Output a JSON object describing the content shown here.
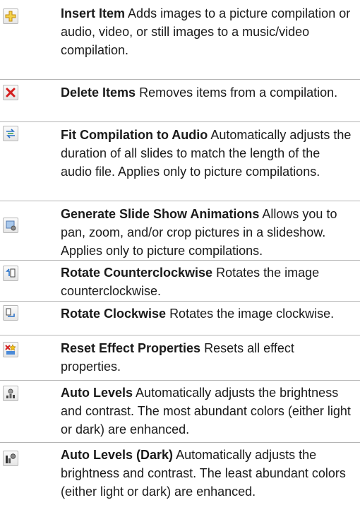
{
  "rows": [
    {
      "icon": "insert-item-icon",
      "title": "Insert Item",
      "desc": "Adds images to a picture compilation or audio, video, or still images to a music/video compilation."
    },
    {
      "icon": "delete-items-icon",
      "title": "Delete Items",
      "desc": "Removes items from a compilation."
    },
    {
      "icon": "fit-compilation-to-audio-icon",
      "title": "Fit Compilation to Audio",
      "desc": "Automatically adjusts the duration of all slides to match the length of the audio file. Applies only to picture compilations."
    },
    {
      "icon": "generate-slide-show-animations-icon",
      "title": "Generate Slide Show Animations",
      "desc": "Allows you to pan, zoom, and/or crop pictures in a slideshow. Applies only to picture compilations."
    },
    {
      "icon": "rotate-counterclockwise-icon",
      "title": "Rotate Counterclockwise",
      "desc": "Rotates the image counterclockwise."
    },
    {
      "icon": "rotate-clockwise-icon",
      "title": "Rotate Clockwise",
      "desc": "Rotates the image clockwise."
    },
    {
      "icon": "reset-effect-properties-icon",
      "title": "Reset Effect Properties",
      "desc": "Resets all effect properties."
    },
    {
      "icon": "auto-levels-icon",
      "title": "Auto Levels",
      "desc": "Automatically adjusts the brightness and contrast. The most abundant colors (either light or dark) are enhanced."
    },
    {
      "icon": "auto-levels-dark-icon",
      "title": "Auto Levels (Dark)",
      "desc": "Automatically adjusts the brightness and contrast. The least abundant colors (either light or dark) are enhanced."
    }
  ]
}
